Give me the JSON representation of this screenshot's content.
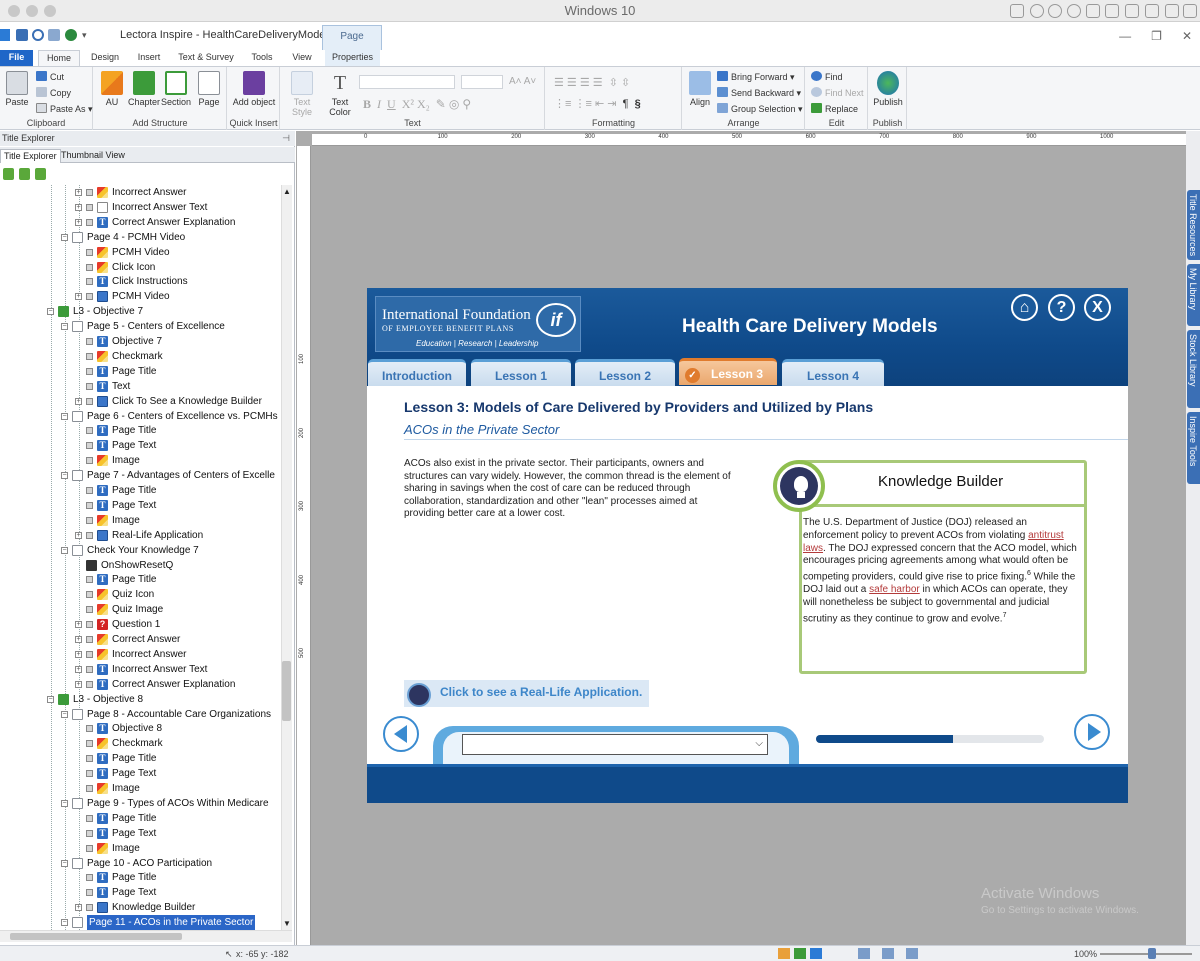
{
  "window": {
    "os_title": "Windows 10",
    "doc_title": "Lectora Inspire - HealthCareDeliveryModels.awt",
    "context_tab": "Page"
  },
  "tabs": [
    "File",
    "Home",
    "Design",
    "Insert",
    "Text & Survey",
    "Tools",
    "View",
    "Properties"
  ],
  "ribbon": {
    "clipboard": {
      "label": "Clipboard",
      "paste": "Paste",
      "cut": "Cut",
      "copy": "Copy",
      "paste_as": "Paste As"
    },
    "add_structure": {
      "label": "Add Structure",
      "au": "AU",
      "chapter": "Chapter",
      "section": "Section",
      "page": "Page"
    },
    "quick_insert": {
      "label": "Quick Insert",
      "add_object": "Add object"
    },
    "text": {
      "label": "Text",
      "text_style": "Text Style",
      "text_color": "Text Color"
    },
    "formatting": {
      "label": "Formatting"
    },
    "arrange": {
      "label": "Arrange",
      "align": "Align",
      "bring_forward": "Bring Forward",
      "send_backward": "Send Backward",
      "group_selection": "Group Selection"
    },
    "edit": {
      "label": "Edit",
      "find": "Find",
      "find_next": "Find Next",
      "replace": "Replace"
    },
    "publish": {
      "label": "Publish",
      "publish": "Publish"
    }
  },
  "panel": {
    "title": "Title Explorer",
    "tabs": [
      "Title Explorer",
      "Thumbnail View"
    ],
    "tree": [
      {
        "label": "Incorrect Answer",
        "icon": "image",
        "depth": 4,
        "exp": true,
        "chk": true
      },
      {
        "label": "Incorrect Answer Text",
        "icon": "text",
        "depth": 4,
        "exp": true,
        "chk": true,
        "blank": true
      },
      {
        "label": "Correct Answer Explanation",
        "icon": "text",
        "depth": 4,
        "exp": true,
        "chk": true
      },
      {
        "label": "Page 4 - PCMH Video",
        "icon": "page",
        "depth": 3,
        "exp": true
      },
      {
        "label": "PCMH Video",
        "icon": "image",
        "depth": 4,
        "chk": true
      },
      {
        "label": "Click Icon",
        "icon": "image",
        "depth": 4,
        "chk": true
      },
      {
        "label": "Click Instructions",
        "icon": "text",
        "depth": 4,
        "chk": true
      },
      {
        "label": "PCMH Video",
        "icon": "group",
        "depth": 4,
        "exp": true,
        "chk": true
      },
      {
        "label": "L3 - Objective 7",
        "icon": "chapter",
        "depth": 2,
        "exp": true
      },
      {
        "label": "Page 5 - Centers of Excellence",
        "icon": "page",
        "depth": 3,
        "exp": true
      },
      {
        "label": "Objective 7",
        "icon": "text",
        "depth": 4,
        "chk": true
      },
      {
        "label": "Checkmark",
        "icon": "image",
        "depth": 4,
        "chk": true
      },
      {
        "label": "Page Title",
        "icon": "text",
        "depth": 4,
        "chk": true
      },
      {
        "label": "Text",
        "icon": "text",
        "depth": 4,
        "chk": true
      },
      {
        "label": "Click To See a Knowledge Builder",
        "icon": "group",
        "depth": 4,
        "exp": true,
        "chk": true
      },
      {
        "label": "Page 6 - Centers of Excellence vs. PCMHs",
        "icon": "page",
        "depth": 3,
        "exp": true
      },
      {
        "label": "Page Title",
        "icon": "text",
        "depth": 4,
        "chk": true
      },
      {
        "label": "Page Text",
        "icon": "text",
        "depth": 4,
        "chk": true
      },
      {
        "label": "Image",
        "icon": "image",
        "depth": 4,
        "chk": true
      },
      {
        "label": "Page 7 - Advantages of Centers of Excelle",
        "icon": "page",
        "depth": 3,
        "exp": true
      },
      {
        "label": "Page Title",
        "icon": "text",
        "depth": 4,
        "chk": true
      },
      {
        "label": "Page Text",
        "icon": "text",
        "depth": 4,
        "chk": true
      },
      {
        "label": "Image",
        "icon": "image",
        "depth": 4,
        "chk": true
      },
      {
        "label": "Real-Life Application",
        "icon": "group",
        "depth": 4,
        "exp": true,
        "chk": true
      },
      {
        "label": "Check Your Knowledge 7",
        "icon": "page",
        "depth": 3,
        "exp": true
      },
      {
        "label": "OnShowResetQ",
        "icon": "action",
        "depth": 4
      },
      {
        "label": "Page Title",
        "icon": "text",
        "depth": 4,
        "chk": true
      },
      {
        "label": "Quiz Icon",
        "icon": "image",
        "depth": 4,
        "chk": true
      },
      {
        "label": "Quiz Image",
        "icon": "image",
        "depth": 4,
        "chk": true
      },
      {
        "label": "Question 1",
        "icon": "question",
        "depth": 4,
        "exp": true,
        "chk": true
      },
      {
        "label": "Correct Answer",
        "icon": "image",
        "depth": 4,
        "exp": true,
        "chk": true
      },
      {
        "label": "Incorrect Answer",
        "icon": "image",
        "depth": 4,
        "exp": true,
        "chk": true
      },
      {
        "label": "Incorrect Answer Text",
        "icon": "text",
        "depth": 4,
        "exp": true,
        "chk": true
      },
      {
        "label": "Correct Answer Explanation",
        "icon": "text",
        "depth": 4,
        "exp": true,
        "chk": true
      },
      {
        "label": "L3 - Objective 8",
        "icon": "chapter",
        "depth": 2,
        "exp": true
      },
      {
        "label": "Page 8 - Accountable Care Organizations",
        "icon": "page",
        "depth": 3,
        "exp": true
      },
      {
        "label": "Objective 8",
        "icon": "text",
        "depth": 4,
        "chk": true
      },
      {
        "label": "Checkmark",
        "icon": "image",
        "depth": 4,
        "chk": true
      },
      {
        "label": "Page Title",
        "icon": "text",
        "depth": 4,
        "chk": true
      },
      {
        "label": "Page Text",
        "icon": "text",
        "depth": 4,
        "chk": true
      },
      {
        "label": "Image",
        "icon": "image",
        "depth": 4,
        "chk": true
      },
      {
        "label": "Page 9 - Types of ACOs Within Medicare",
        "icon": "page",
        "depth": 3,
        "exp": true
      },
      {
        "label": "Page Title",
        "icon": "text",
        "depth": 4,
        "chk": true
      },
      {
        "label": "Page Text",
        "icon": "text",
        "depth": 4,
        "chk": true
      },
      {
        "label": "Image",
        "icon": "image",
        "depth": 4,
        "chk": true
      },
      {
        "label": "Page 10 - ACO Participation",
        "icon": "page",
        "depth": 3,
        "exp": true
      },
      {
        "label": "Page Title",
        "icon": "text",
        "depth": 4,
        "chk": true
      },
      {
        "label": "Page Text",
        "icon": "text",
        "depth": 4,
        "chk": true
      },
      {
        "label": "Knowledge Builder",
        "icon": "group",
        "depth": 4,
        "exp": true,
        "chk": true
      },
      {
        "label": "Page 11 - ACOs in the Private Sector",
        "icon": "page",
        "depth": 3,
        "exp": true,
        "selected": true
      }
    ]
  },
  "ruler": {
    "ticks": [
      "0",
      "100",
      "200",
      "300",
      "400",
      "500",
      "600",
      "700",
      "800",
      "900",
      "1000"
    ],
    "vticks": [
      "100",
      "200",
      "300",
      "400",
      "500"
    ]
  },
  "side_tabs": [
    "Title Resources",
    "My Library",
    "Stock Library",
    "Inspire Tools"
  ],
  "course": {
    "logo": {
      "line1": "International Foundation",
      "line2": "OF EMPLOYEE BENEFIT PLANS",
      "line3": "Education | Research | Leadership",
      "mark": "if"
    },
    "title": "Health Care Delivery Models",
    "home_icon": "⌂",
    "help_icon": "?",
    "close_icon": "X",
    "tabs": [
      "Introduction",
      "Lesson 1",
      "Lesson 2",
      "Lesson 3",
      "Lesson 4"
    ],
    "active_tab": 3,
    "lesson_heading": "Lesson 3: Models of Care Delivered by Providers and Utilized by Plans",
    "lesson_sub": "ACOs in the Private Sector",
    "body": "ACOs also exist in the private sector. Their participants, owners and structures can vary widely. However, the common thread is the element of sharing in savings when the cost of care can be reduced through collaboration, standardization and other \"lean\" processes aimed at providing better care at a lower cost.",
    "kb_title": "Knowledge Builder",
    "kb_text_1": "The U.S. Department of Justice (DOJ) released an enforcement policy to prevent ACOs from violating ",
    "kb_link_1": "antitrust laws",
    "kb_text_2": ". The DOJ expressed concern that the ACO model, which encourages pricing agreements among what would often be competing providers, could give rise to price fixing.",
    "kb_sup_1": "6",
    "kb_text_3": " While the DOJ laid out a ",
    "kb_link_2": "safe harbor",
    "kb_text_4": " in which ACOs can operate, they will nonetheless be subject to governmental and judicial scrutiny as they continue to grow and evolve.",
    "kb_sup_2": "7",
    "real_life": "Click to see a Real-Life Application.",
    "progress": 0.6
  },
  "status": {
    "coords": "x: -65  y: -182",
    "zoom": "100%"
  },
  "watermark": {
    "line1": "Activate Windows",
    "line2": "Go to Settings to activate Windows."
  }
}
